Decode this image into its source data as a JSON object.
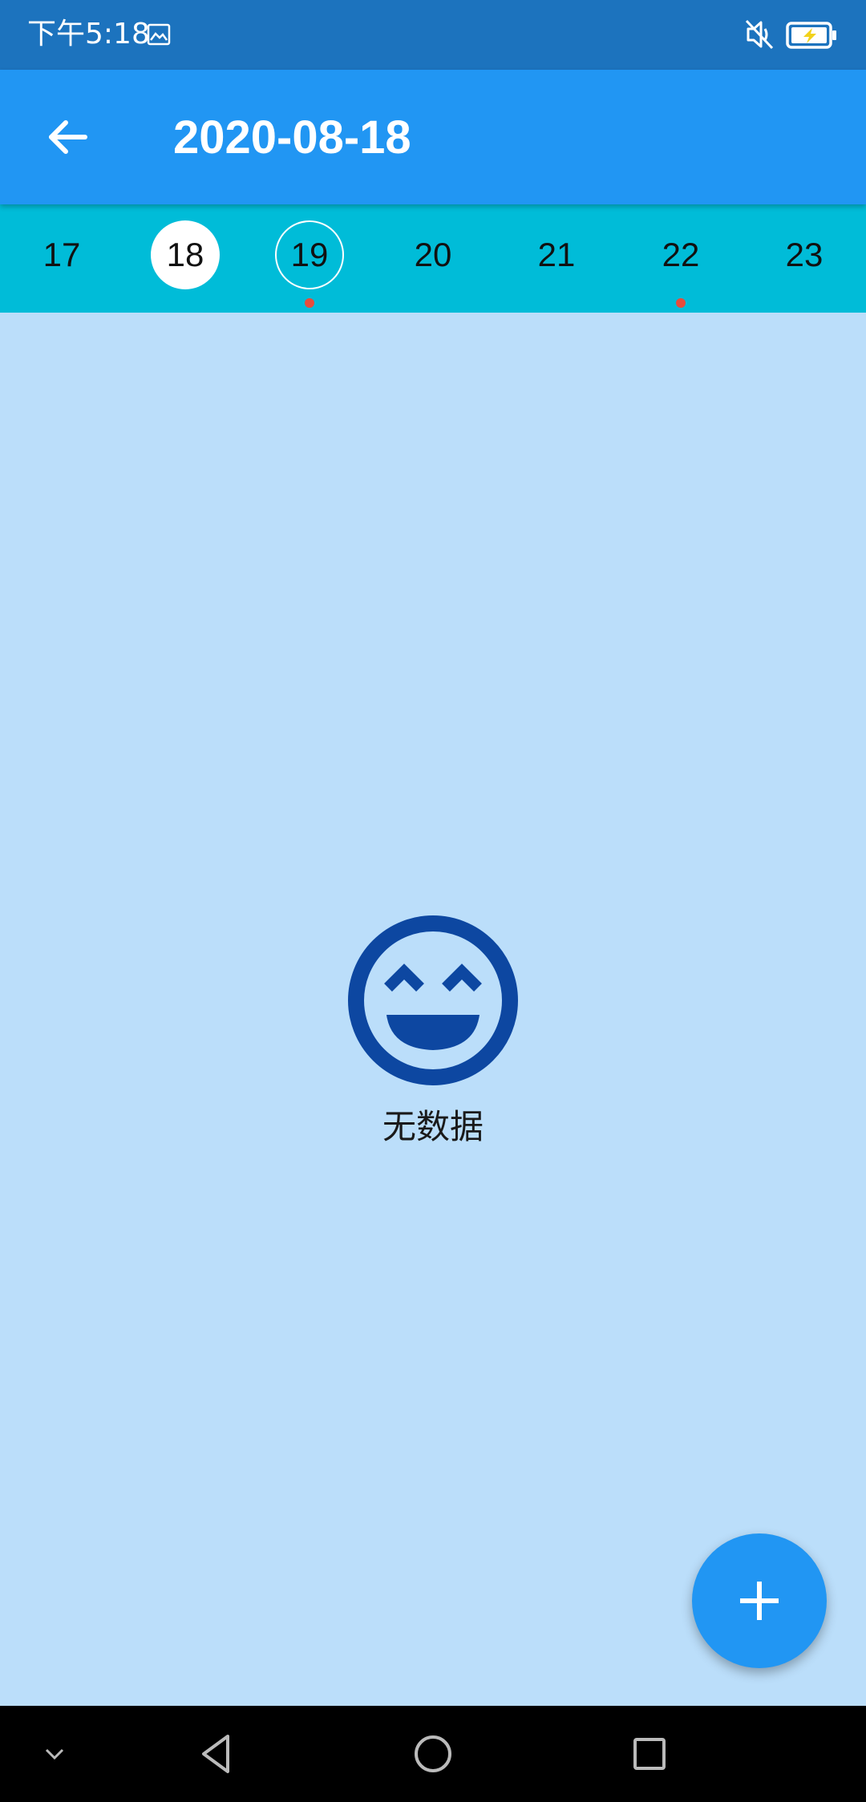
{
  "status_bar": {
    "time": "下午5:18",
    "icons": [
      "image-icon",
      "mute-icon",
      "battery-charging-icon"
    ]
  },
  "app_bar": {
    "title": "2020-08-18",
    "back_icon": "arrow-left-icon"
  },
  "date_strip": {
    "days": [
      {
        "label": "17",
        "selected": false,
        "today": false,
        "has_event": false
      },
      {
        "label": "18",
        "selected": true,
        "today": false,
        "has_event": false
      },
      {
        "label": "19",
        "selected": false,
        "today": true,
        "has_event": true
      },
      {
        "label": "20",
        "selected": false,
        "today": false,
        "has_event": false
      },
      {
        "label": "21",
        "selected": false,
        "today": false,
        "has_event": false
      },
      {
        "label": "22",
        "selected": false,
        "today": false,
        "has_event": true
      },
      {
        "label": "23",
        "selected": false,
        "today": false,
        "has_event": false
      }
    ]
  },
  "empty_state": {
    "icon": "smiley-icon",
    "label": "无数据"
  },
  "fab": {
    "icon": "plus-icon"
  },
  "nav_bar": {
    "buttons": [
      "chevron-down-icon",
      "back-triangle-icon",
      "home-circle-icon",
      "recents-square-icon"
    ]
  },
  "colors": {
    "status_bar": "#1C73BE",
    "app_bar": "#2196F3",
    "date_strip": "#00BCD8",
    "background": "#BBDEFA",
    "smiley": "#0D47A1",
    "event_dot": "#E74C3C",
    "fab": "#2196F3"
  }
}
